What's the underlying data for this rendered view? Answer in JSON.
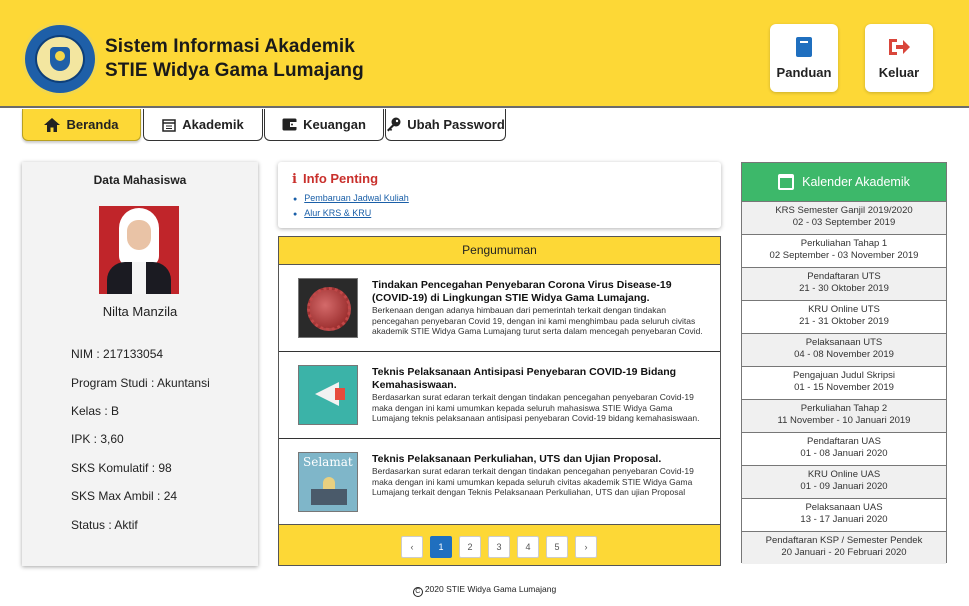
{
  "header": {
    "title_line1": "Sistem Informasi Akademik",
    "title_line2": "STIE Widya Gama Lumajang",
    "logo_icon": "university-logo",
    "buttons": [
      {
        "label": "Panduan",
        "icon": "book-icon",
        "color": "#1f6fbf"
      },
      {
        "label": "Keluar",
        "icon": "sign-out-icon",
        "color": "#d9463b"
      }
    ]
  },
  "tabs": [
    {
      "label": "Beranda",
      "icon": "home-icon",
      "active": true
    },
    {
      "label": "Akademik",
      "icon": "calendar-icon",
      "active": false
    },
    {
      "label": "Keuangan",
      "icon": "wallet-icon",
      "active": false
    },
    {
      "label": "Ubah Password",
      "icon": "key-icon",
      "active": false
    }
  ],
  "student": {
    "section_title": "Data Mahasiswa",
    "name": "Nilta Manzila",
    "fields": [
      "NIM : 217133054",
      "Program Studi : Akuntansi",
      "Kelas : B",
      "IPK : 3,60",
      "SKS Komulatif : 98",
      "SKS Max Ambil : 24",
      "Status : Aktif"
    ]
  },
  "info_penting": {
    "title": "Info Penting",
    "links": [
      "Pembaruan Jadwal Kuliah",
      "Alur KRS & KRU"
    ]
  },
  "pengumuman": {
    "title": "Pengumuman",
    "items": [
      {
        "title": "Tindakan Pencegahan Penyebaran Corona Virus Disease-19 (COVID-19) di Lingkungan STIE Widya Gama Lumajang.",
        "desc": "Berkenaan dengan adanya himbauan dari pemerintah terkait dengan tindakan pencegahan penyebaran Covid 19, dengan ini kami menghimbau pada seluruh civitas akademik STIE Widya Gama Lumajang turut serta dalam mencegah penyebaran Covid."
      },
      {
        "title": "Teknis Pelaksanaan Antisipasi Penyebaran COVID-19 Bidang Kemahasiswaan.",
        "desc": "Berdasarkan surat edaran terkait dengan tindakan pencegahan penyebaran Covid-19 maka dengan ini kami umumkan kepada seluruh mahasiswa STIE Widya Gama Lumajang teknis pelaksanaan antisipasi penyebaran Covid-19 bidang kemahasiswaan."
      },
      {
        "title": "Teknis Pelaksanaan Perkuliahan, UTS dan Ujian Proposal.",
        "desc": "Berdasarkan surat edaran terkait dengan tindakan pencegahan penyebaran Covid-19 maka dengan ini kami umumkan kepada seluruh civitas akademik STIE Widya Gama Lumajang terkait dengan Teknis Pelaksanaan Perkuliahan, UTS dan ujian Proposal",
        "thumb_text": "Selamat"
      }
    ],
    "pagination": {
      "prev": "‹",
      "next": "›",
      "pages": [
        "1",
        "2",
        "3",
        "4",
        "5"
      ],
      "current": "1"
    }
  },
  "kalender": {
    "title": "Kalender Akademik",
    "events": [
      {
        "name": "KRS Semester Ganjil 2019/2020",
        "date": "02 - 03 September 2019"
      },
      {
        "name": "Perkuliahan Tahap 1",
        "date": "02 September - 03 November 2019"
      },
      {
        "name": "Pendaftaran UTS",
        "date": "21 - 30 Oktober 2019"
      },
      {
        "name": "KRU Online UTS",
        "date": "21 - 31 Oktober 2019"
      },
      {
        "name": "Pelaksanaan UTS",
        "date": "04 - 08 November 2019"
      },
      {
        "name": "Pengajuan Judul Skripsi",
        "date": "01 - 15 November 2019"
      },
      {
        "name": "Perkuliahan Tahap 2",
        "date": "11 November - 10 Januari 2019"
      },
      {
        "name": "Pendaftaran UAS",
        "date": "01 - 08 Januari 2020"
      },
      {
        "name": "KRU Online UAS",
        "date": "01 - 09 Januari 2020"
      },
      {
        "name": "Pelaksanaan UAS",
        "date": "13 - 17 Januari 2020"
      },
      {
        "name": "Pendaftaran KSP / Semester Pendek",
        "date": "20 Januari - 20 Februari 2020"
      }
    ]
  },
  "footer": {
    "copyright_symbol": "C",
    "text": "2020 STIE Widya Gama Lumajang"
  },
  "colors": {
    "header_bg": "#fdd836",
    "calendar_header": "#3db86a",
    "info_title": "#c9302c",
    "pager_active": "#1f6fbf"
  }
}
